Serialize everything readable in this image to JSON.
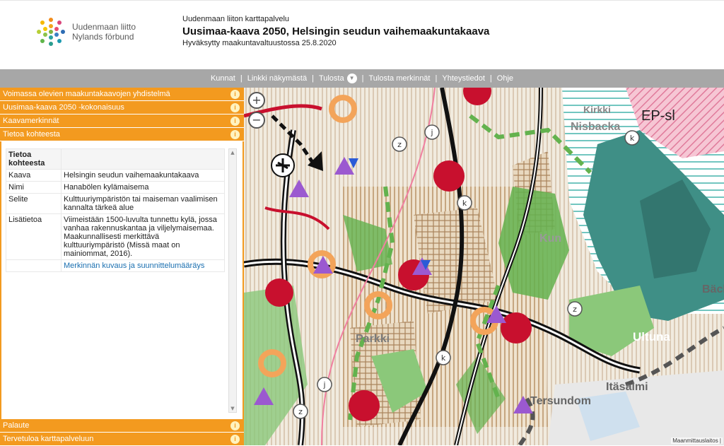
{
  "header": {
    "logo_line1": "Uudenmaan liitto",
    "logo_line2": "Nylands förbund",
    "service": "Uudenmaan liiton karttapalvelu",
    "title": "Uusimaa-kaava 2050, Helsingin seudun vaihemaakuntakaava",
    "subtitle": "Hyväksytty maakuntavaltuustossa 25.8.2020"
  },
  "nav": {
    "items": [
      "Kunnat",
      "Linkki näkymästä",
      "Tulosta",
      "Tulosta merkinnät",
      "Yhteystiedot",
      "Ohje"
    ]
  },
  "panels": {
    "top": [
      "Voimassa olevien maakuntakaavojen yhdistelmä",
      "Uusimaa-kaava 2050 -kokonaisuus",
      "Kaavamerkinnät",
      "Tietoa kohteesta"
    ],
    "bottom": [
      "Palaute",
      "Tervetuloa karttapalveluun"
    ],
    "info_glyph": "i"
  },
  "info": {
    "header": "Tietoa kohteesta",
    "rows": [
      {
        "key": "Kaava",
        "value": "Helsingin seudun vaihemaakuntakaava"
      },
      {
        "key": "Nimi",
        "value": "Hanabölen kylämaisema"
      },
      {
        "key": "Selite",
        "value": "Kulttuuriympäristön tai maiseman vaalimisen kannalta tärkeä alue"
      },
      {
        "key": "Lisätietoa",
        "value": "Viimeistään 1500-luvulta tunnettu kylä, jossa vanhaa rakennuskantaa ja viljelymaisemaa. Maakunnallisesti merkittävä kulttuuriympäristö (Missä maat on mainiommat, 2016)."
      }
    ],
    "link": "Merkinnän kuvaus ja suunnittelumääräys"
  },
  "map": {
    "labels": [
      "EP-sl",
      "Nisbacka",
      "Kirkki",
      "Ultuna",
      "Itäsalmi",
      "Tersundom",
      "Bäck",
      "Parkki",
      "Kun"
    ],
    "credit": "Maanmittauslaitos |",
    "zoom_in": "+",
    "zoom_out": "−",
    "letters": [
      "z",
      "j",
      "k",
      "z",
      "k",
      "j",
      "z",
      "k"
    ]
  },
  "colors": {
    "orange": "#f39a1f",
    "nav_gray": "#a7a7a7",
    "teal": "#3f8f86",
    "green": "#63b24e",
    "red": "#c8102e",
    "purple": "#9b59d0"
  }
}
